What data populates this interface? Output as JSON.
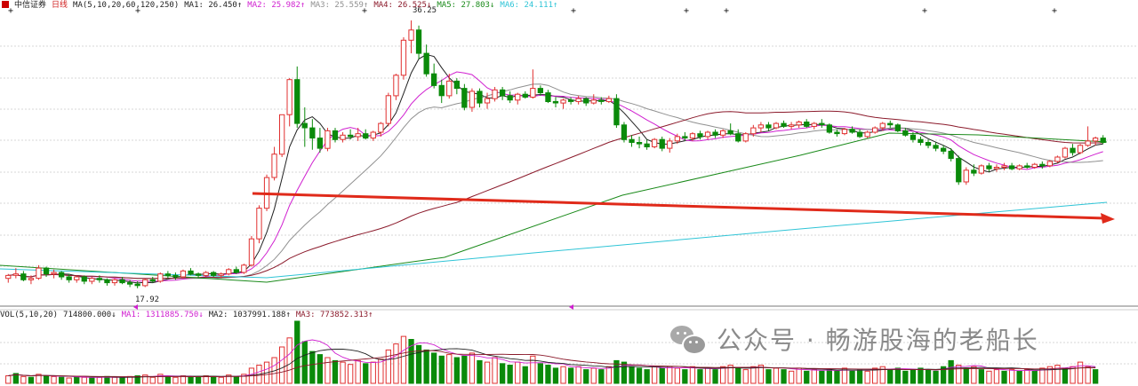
{
  "header": {
    "stock_name": "中信证券",
    "period": "日线",
    "ma_label": "MA(5,10,20,60,120,250)",
    "ma": [
      {
        "label": "MA1: 26.450↑",
        "color": "#222222"
      },
      {
        "label": "MA2: 25.982↑",
        "color": "#d020d0"
      },
      {
        "label": "MA3: 25.559↑",
        "color": "#909090"
      },
      {
        "label": "MA4: 26.525↓",
        "color": "#8b1a2b"
      },
      {
        "label": "MA5: 27.803↓",
        "color": "#1a8a1a"
      },
      {
        "label": "MA6: 24.111↑",
        "color": "#2ec4d6"
      }
    ]
  },
  "volume_header": {
    "label": "VOL(5,10,20)",
    "value": "714800.000↓",
    "ma": [
      {
        "label": "MA1: 1311885.750↓",
        "color": "#d020d0"
      },
      {
        "label": "MA2: 1037991.188↑",
        "color": "#222222"
      },
      {
        "label": "MA3: 773852.313↑",
        "color": "#8b1a2b"
      }
    ]
  },
  "annotations": {
    "high_label": "36.25",
    "low_label": "17.92"
  },
  "watermark": {
    "text": "公众号 · 畅游股海的老船长"
  },
  "colors": {
    "up": "#e03030",
    "down": "#0a8a0a",
    "grid": "#b0b0b0",
    "arrow": "#e02a1a"
  },
  "chart_data": {
    "type": "candlestick",
    "title": "中信证券 日线",
    "y_marks": {
      "high": 36.25,
      "low": 17.92
    },
    "grid": true,
    "candles": [
      [
        18.6,
        18.9,
        18.3,
        18.8
      ],
      [
        18.8,
        19.3,
        18.6,
        18.9
      ],
      [
        18.9,
        19.1,
        18.4,
        18.5
      ],
      [
        18.5,
        18.8,
        18.2,
        18.6
      ],
      [
        18.6,
        19.5,
        18.5,
        19.3
      ],
      [
        19.3,
        19.4,
        18.7,
        18.9
      ],
      [
        18.9,
        19.2,
        18.6,
        19.0
      ],
      [
        19.0,
        19.1,
        18.5,
        18.7
      ],
      [
        18.7,
        18.9,
        18.3,
        18.5
      ],
      [
        18.5,
        18.8,
        18.3,
        18.7
      ],
      [
        18.7,
        18.8,
        18.2,
        18.4
      ],
      [
        18.4,
        18.7,
        18.2,
        18.6
      ],
      [
        18.6,
        18.8,
        18.3,
        18.5
      ],
      [
        18.5,
        18.6,
        18.1,
        18.3
      ],
      [
        18.3,
        18.6,
        18.1,
        18.5
      ],
      [
        18.5,
        18.7,
        18.2,
        18.3
      ],
      [
        18.3,
        18.5,
        18.0,
        18.2
      ],
      [
        18.2,
        18.4,
        17.92,
        18.1
      ],
      [
        18.1,
        18.6,
        18.0,
        18.5
      ],
      [
        18.5,
        18.7,
        18.3,
        18.4
      ],
      [
        18.4,
        19.0,
        18.3,
        18.9
      ],
      [
        18.9,
        19.1,
        18.6,
        18.8
      ],
      [
        18.8,
        19.0,
        18.5,
        18.7
      ],
      [
        18.7,
        19.2,
        18.6,
        19.1
      ],
      [
        19.1,
        19.3,
        18.8,
        18.9
      ],
      [
        18.9,
        19.0,
        18.6,
        18.8
      ],
      [
        18.8,
        19.1,
        18.7,
        19.0
      ],
      [
        19.0,
        19.1,
        18.7,
        18.8
      ],
      [
        18.8,
        19.0,
        18.6,
        18.9
      ],
      [
        18.9,
        19.3,
        18.8,
        19.2
      ],
      [
        19.2,
        19.4,
        18.9,
        19.0
      ],
      [
        19.0,
        19.6,
        18.9,
        19.5
      ],
      [
        19.5,
        21.5,
        19.4,
        21.3
      ],
      [
        21.3,
        23.6,
        21.0,
        23.4
      ],
      [
        23.4,
        25.7,
        23.2,
        25.5
      ],
      [
        25.5,
        27.6,
        25.3,
        27.1
      ],
      [
        27.1,
        29.8,
        26.9,
        29.8
      ],
      [
        29.8,
        32.3,
        29.0,
        32.2
      ],
      [
        32.2,
        33.1,
        28.9,
        29.2
      ],
      [
        29.2,
        30.3,
        27.6,
        28.9
      ],
      [
        28.9,
        29.5,
        27.4,
        28.2
      ],
      [
        28.2,
        28.9,
        27.2,
        27.5
      ],
      [
        27.5,
        28.9,
        27.3,
        28.7
      ],
      [
        28.7,
        28.9,
        27.9,
        28.1
      ],
      [
        28.1,
        28.6,
        27.9,
        28.4
      ],
      [
        28.4,
        28.8,
        28.1,
        28.3
      ],
      [
        28.3,
        28.9,
        28.0,
        28.5
      ],
      [
        28.5,
        28.8,
        28.1,
        28.2
      ],
      [
        28.2,
        28.7,
        28.0,
        28.6
      ],
      [
        28.6,
        29.3,
        28.3,
        29.2
      ],
      [
        29.2,
        31.3,
        29.0,
        31.1
      ],
      [
        31.1,
        32.6,
        30.8,
        32.5
      ],
      [
        32.5,
        35.1,
        32.2,
        34.9
      ],
      [
        34.9,
        36.25,
        34.0,
        35.6
      ],
      [
        35.6,
        35.9,
        33.6,
        34.0
      ],
      [
        34.0,
        34.6,
        32.4,
        32.6
      ],
      [
        32.6,
        33.3,
        31.6,
        31.8
      ],
      [
        31.8,
        32.2,
        30.6,
        31.1
      ],
      [
        31.1,
        32.6,
        30.9,
        32.1
      ],
      [
        32.1,
        32.3,
        31.2,
        31.6
      ],
      [
        31.6,
        31.9,
        30.1,
        30.3
      ],
      [
        30.3,
        31.6,
        30.0,
        31.4
      ],
      [
        31.4,
        31.6,
        30.3,
        30.6
      ],
      [
        30.6,
        31.3,
        30.2,
        30.9
      ],
      [
        30.9,
        31.7,
        30.7,
        31.5
      ],
      [
        31.5,
        31.7,
        30.8,
        31.1
      ],
      [
        31.1,
        31.4,
        30.6,
        30.8
      ],
      [
        30.8,
        31.3,
        30.5,
        31.2
      ],
      [
        31.2,
        31.4,
        30.9,
        31.0
      ],
      [
        31.0,
        32.9,
        30.9,
        31.6
      ],
      [
        31.6,
        31.8,
        31.1,
        31.3
      ],
      [
        31.3,
        31.5,
        30.6,
        30.7
      ],
      [
        30.7,
        31.0,
        30.3,
        30.6
      ],
      [
        30.6,
        30.9,
        30.2,
        30.8
      ],
      [
        30.8,
        31.0,
        30.5,
        30.7
      ],
      [
        30.7,
        31.1,
        30.5,
        30.9
      ],
      [
        30.9,
        31.0,
        30.4,
        30.6
      ],
      [
        30.6,
        31.2,
        30.5,
        30.8
      ],
      [
        30.8,
        31.0,
        30.5,
        30.7
      ],
      [
        30.7,
        31.1,
        30.6,
        30.9
      ],
      [
        30.9,
        31.2,
        28.9,
        29.1
      ],
      [
        29.1,
        29.3,
        27.9,
        28.1
      ],
      [
        28.1,
        28.4,
        27.6,
        27.9
      ],
      [
        27.9,
        28.3,
        27.5,
        27.8
      ],
      [
        27.8,
        28.1,
        27.4,
        27.6
      ],
      [
        27.6,
        28.2,
        27.5,
        28.1
      ],
      [
        28.1,
        28.3,
        27.3,
        27.5
      ],
      [
        27.5,
        28.2,
        27.2,
        28.0
      ],
      [
        28.0,
        28.5,
        27.8,
        28.3
      ],
      [
        28.3,
        28.6,
        28.0,
        28.2
      ],
      [
        28.2,
        28.6,
        28.0,
        28.5
      ],
      [
        28.5,
        28.7,
        28.1,
        28.3
      ],
      [
        28.3,
        28.7,
        28.1,
        28.6
      ],
      [
        28.6,
        28.8,
        28.2,
        28.4
      ],
      [
        28.4,
        28.8,
        28.2,
        28.7
      ],
      [
        28.7,
        29.2,
        28.4,
        28.5
      ],
      [
        28.5,
        28.8,
        27.9,
        28.0
      ],
      [
        28.0,
        28.6,
        27.9,
        28.5
      ],
      [
        28.5,
        29.1,
        28.3,
        28.9
      ],
      [
        28.9,
        29.3,
        28.6,
        29.1
      ],
      [
        29.1,
        29.3,
        28.7,
        28.9
      ],
      [
        28.9,
        29.3,
        28.8,
        29.2
      ],
      [
        29.2,
        29.4,
        28.9,
        29.0
      ],
      [
        29.0,
        29.3,
        28.8,
        29.1
      ],
      [
        29.1,
        29.4,
        28.9,
        29.3
      ],
      [
        29.3,
        29.5,
        28.9,
        29.0
      ],
      [
        29.0,
        29.3,
        28.8,
        29.2
      ],
      [
        29.2,
        29.5,
        28.9,
        29.1
      ],
      [
        29.1,
        29.2,
        28.5,
        28.6
      ],
      [
        28.6,
        28.8,
        28.3,
        28.5
      ],
      [
        28.5,
        28.9,
        28.4,
        28.8
      ],
      [
        28.8,
        29.0,
        28.5,
        28.6
      ],
      [
        28.6,
        28.8,
        28.2,
        28.3
      ],
      [
        28.3,
        28.7,
        28.2,
        28.6
      ],
      [
        28.6,
        29.0,
        28.5,
        28.9
      ],
      [
        28.9,
        29.3,
        28.7,
        29.2
      ],
      [
        29.2,
        29.4,
        28.9,
        29.1
      ],
      [
        29.1,
        29.2,
        28.6,
        28.7
      ],
      [
        28.7,
        28.9,
        28.3,
        28.4
      ],
      [
        28.4,
        28.6,
        27.9,
        28.1
      ],
      [
        28.1,
        28.3,
        27.7,
        27.9
      ],
      [
        27.9,
        28.1,
        27.5,
        27.7
      ],
      [
        27.7,
        27.9,
        27.3,
        27.5
      ],
      [
        27.5,
        27.7,
        27.1,
        27.3
      ],
      [
        27.3,
        27.5,
        26.6,
        26.8
      ],
      [
        26.8,
        27.0,
        25.0,
        25.2
      ],
      [
        25.2,
        26.2,
        25.0,
        26.0
      ],
      [
        26.0,
        26.4,
        25.6,
        25.8
      ],
      [
        25.8,
        26.4,
        25.7,
        26.3
      ],
      [
        26.3,
        26.5,
        25.9,
        26.1
      ],
      [
        26.1,
        26.4,
        25.9,
        26.2
      ],
      [
        26.2,
        26.5,
        26.0,
        26.3
      ],
      [
        26.3,
        26.5,
        26.0,
        26.1
      ],
      [
        26.1,
        26.4,
        26.0,
        26.3
      ],
      [
        26.3,
        26.5,
        26.1,
        26.2
      ],
      [
        26.2,
        26.5,
        26.1,
        26.4
      ],
      [
        26.4,
        26.6,
        26.1,
        26.3
      ],
      [
        26.3,
        26.7,
        26.2,
        26.6
      ],
      [
        26.6,
        27.0,
        26.5,
        26.9
      ],
      [
        26.9,
        27.6,
        26.8,
        27.5
      ],
      [
        27.5,
        27.8,
        27.0,
        27.2
      ],
      [
        27.2,
        27.8,
        27.1,
        27.7
      ],
      [
        27.7,
        29.0,
        27.6,
        28.0
      ],
      [
        28.0,
        28.3,
        27.7,
        28.2
      ],
      [
        28.2,
        28.4,
        27.8,
        27.9
      ]
    ],
    "volumes": [
      [
        10,
        1
      ],
      [
        13,
        0
      ],
      [
        9,
        1
      ],
      [
        8,
        0
      ],
      [
        12,
        1
      ],
      [
        10,
        0
      ],
      [
        9,
        1
      ],
      [
        8,
        0
      ],
      [
        7,
        1
      ],
      [
        9,
        0
      ],
      [
        8,
        1
      ],
      [
        7,
        0
      ],
      [
        8,
        1
      ],
      [
        9,
        0
      ],
      [
        8,
        1
      ],
      [
        7,
        0
      ],
      [
        9,
        1
      ],
      [
        10,
        0
      ],
      [
        11,
        1
      ],
      [
        8,
        1
      ],
      [
        12,
        1
      ],
      [
        9,
        0
      ],
      [
        8,
        1
      ],
      [
        10,
        1
      ],
      [
        9,
        0
      ],
      [
        8,
        0
      ],
      [
        10,
        1
      ],
      [
        9,
        0
      ],
      [
        8,
        1
      ],
      [
        11,
        1
      ],
      [
        9,
        0
      ],
      [
        12,
        1
      ],
      [
        20,
        1
      ],
      [
        24,
        1
      ],
      [
        28,
        1
      ],
      [
        34,
        1
      ],
      [
        48,
        1
      ],
      [
        60,
        1
      ],
      [
        82,
        0
      ],
      [
        55,
        0
      ],
      [
        42,
        0
      ],
      [
        38,
        0
      ],
      [
        34,
        1
      ],
      [
        30,
        0
      ],
      [
        28,
        1
      ],
      [
        25,
        1
      ],
      [
        30,
        1
      ],
      [
        26,
        0
      ],
      [
        28,
        1
      ],
      [
        32,
        1
      ],
      [
        44,
        1
      ],
      [
        52,
        1
      ],
      [
        62,
        1
      ],
      [
        58,
        0
      ],
      [
        50,
        0
      ],
      [
        44,
        0
      ],
      [
        40,
        0
      ],
      [
        36,
        0
      ],
      [
        38,
        1
      ],
      [
        34,
        0
      ],
      [
        36,
        0
      ],
      [
        40,
        1
      ],
      [
        30,
        0
      ],
      [
        28,
        1
      ],
      [
        34,
        1
      ],
      [
        26,
        0
      ],
      [
        24,
        0
      ],
      [
        28,
        1
      ],
      [
        22,
        0
      ],
      [
        36,
        1
      ],
      [
        26,
        0
      ],
      [
        24,
        0
      ],
      [
        20,
        0
      ],
      [
        22,
        1
      ],
      [
        20,
        0
      ],
      [
        22,
        1
      ],
      [
        18,
        0
      ],
      [
        20,
        1
      ],
      [
        18,
        0
      ],
      [
        22,
        1
      ],
      [
        30,
        0
      ],
      [
        28,
        0
      ],
      [
        22,
        0
      ],
      [
        20,
        0
      ],
      [
        18,
        0
      ],
      [
        22,
        1
      ],
      [
        20,
        0
      ],
      [
        22,
        1
      ],
      [
        20,
        1
      ],
      [
        18,
        0
      ],
      [
        22,
        1
      ],
      [
        18,
        0
      ],
      [
        20,
        1
      ],
      [
        18,
        0
      ],
      [
        22,
        1
      ],
      [
        24,
        1
      ],
      [
        20,
        0
      ],
      [
        18,
        1
      ],
      [
        22,
        1
      ],
      [
        24,
        1
      ],
      [
        18,
        0
      ],
      [
        20,
        1
      ],
      [
        18,
        0
      ],
      [
        16,
        1
      ],
      [
        20,
        1
      ],
      [
        16,
        0
      ],
      [
        18,
        1
      ],
      [
        16,
        0
      ],
      [
        18,
        0
      ],
      [
        16,
        0
      ],
      [
        20,
        1
      ],
      [
        16,
        0
      ],
      [
        18,
        0
      ],
      [
        16,
        1
      ],
      [
        20,
        1
      ],
      [
        22,
        1
      ],
      [
        18,
        0
      ],
      [
        20,
        0
      ],
      [
        16,
        0
      ],
      [
        18,
        0
      ],
      [
        20,
        0
      ],
      [
        18,
        0
      ],
      [
        16,
        0
      ],
      [
        22,
        0
      ],
      [
        30,
        0
      ],
      [
        24,
        1
      ],
      [
        20,
        0
      ],
      [
        22,
        1
      ],
      [
        18,
        0
      ],
      [
        16,
        1
      ],
      [
        18,
        1
      ],
      [
        16,
        0
      ],
      [
        18,
        1
      ],
      [
        16,
        0
      ],
      [
        18,
        1
      ],
      [
        16,
        0
      ],
      [
        20,
        1
      ],
      [
        22,
        1
      ],
      [
        24,
        1
      ],
      [
        20,
        0
      ],
      [
        22,
        1
      ],
      [
        28,
        1
      ],
      [
        22,
        1
      ],
      [
        18,
        0
      ]
    ]
  }
}
